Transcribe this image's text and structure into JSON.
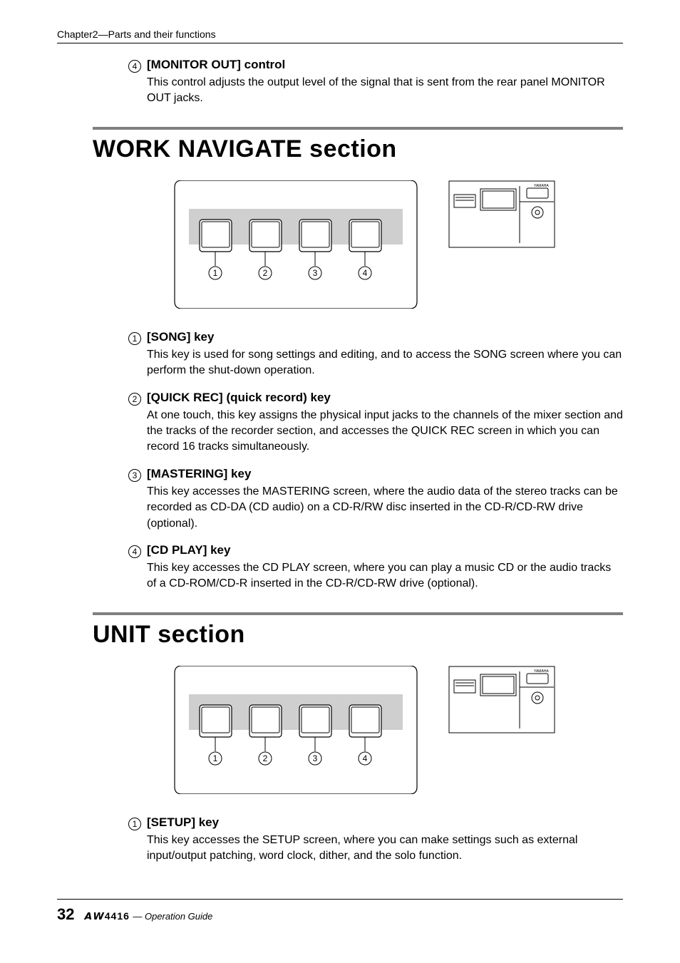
{
  "running_head": "Chapter2—Parts and their functions",
  "top_item": {
    "num": "4",
    "title": "[MONITOR OUT] control",
    "body": "This control adjusts the output level of the signal that is sent from the rear panel MONITOR OUT jacks."
  },
  "section1": {
    "title": "WORK NAVIGATE section",
    "diagram_labels": [
      "1",
      "2",
      "3",
      "4"
    ],
    "items": [
      {
        "num": "1",
        "title": "[SONG] key",
        "body": "This key is used for song settings and editing, and to access the SONG screen where you can perform the shut-down operation."
      },
      {
        "num": "2",
        "title": "[QUICK REC] (quick record) key",
        "body": "At one touch, this key assigns the physical input jacks to the channels of the mixer section and the tracks of the recorder section, and accesses the QUICK REC screen in which you can record 16 tracks simultaneously."
      },
      {
        "num": "3",
        "title": "[MASTERING] key",
        "body": "This key accesses the MASTERING screen, where the audio data of the stereo tracks can be recorded as CD-DA (CD audio) on a CD-R/RW disc inserted in the CD-R/CD-RW drive (optional)."
      },
      {
        "num": "4",
        "title": "[CD PLAY] key",
        "body": "This key accesses the CD PLAY screen, where you can play a music CD or the audio tracks of a CD-ROM/CD-R inserted in the CD-R/CD-RW drive (optional)."
      }
    ]
  },
  "section2": {
    "title": "UNIT section",
    "diagram_labels": [
      "1",
      "2",
      "3",
      "4"
    ],
    "items": [
      {
        "num": "1",
        "title": "[SETUP] key",
        "body": "This key accesses the SETUP screen, where you can make settings such as external input/output patching, word clock, dither, and the solo function."
      }
    ]
  },
  "footer": {
    "page": "32",
    "model": "𝘼𝙒4416",
    "sub": "— Operation Guide"
  }
}
